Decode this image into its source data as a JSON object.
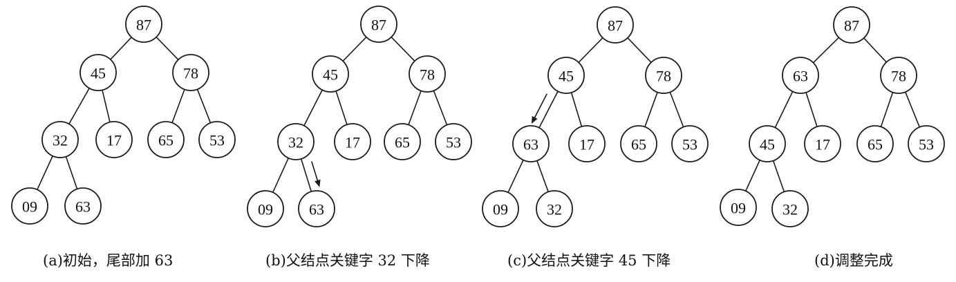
{
  "panels": [
    {
      "id": "a",
      "caption": "(a)初始，尾部加 63",
      "nodes": [
        "87",
        "45",
        "78",
        "32",
        "17",
        "65",
        "53",
        "09",
        "63"
      ],
      "moves": []
    },
    {
      "id": "b",
      "caption": "(b)父结点关键字 32 下降",
      "nodes": [
        "87",
        "45",
        "78",
        "32",
        "17",
        "65",
        "53",
        "09",
        "63"
      ],
      "moves": [
        {
          "from_node": 3,
          "to_node": 8
        }
      ]
    },
    {
      "id": "c",
      "caption": "(c)父结点关键字 45 下降",
      "nodes": [
        "87",
        "45",
        "78",
        "63",
        "17",
        "65",
        "53",
        "09",
        "32"
      ],
      "moves": [
        {
          "from_node": 1,
          "to_node": 3
        }
      ]
    },
    {
      "id": "d",
      "caption": "(d)调整完成",
      "nodes": [
        "87",
        "63",
        "78",
        "45",
        "17",
        "65",
        "53",
        "09",
        "32"
      ],
      "moves": []
    }
  ],
  "tree_edges": [
    [
      0,
      1
    ],
    [
      0,
      2
    ],
    [
      1,
      3
    ],
    [
      1,
      4
    ],
    [
      2,
      5
    ],
    [
      2,
      6
    ],
    [
      3,
      7
    ],
    [
      3,
      8
    ]
  ]
}
